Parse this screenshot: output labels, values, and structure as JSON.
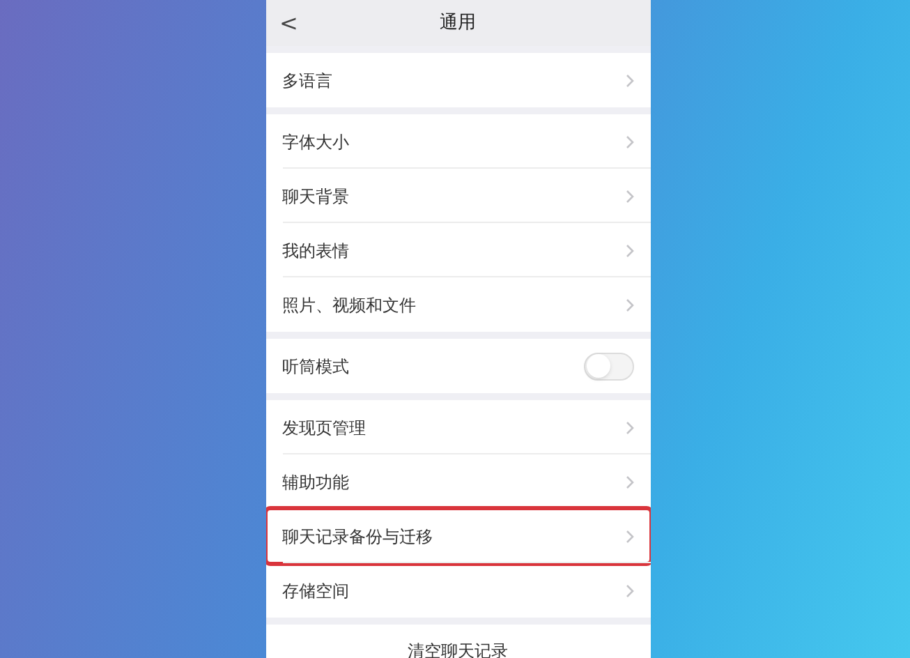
{
  "header": {
    "back": "<",
    "title": "通用"
  },
  "groups": [
    {
      "items": [
        {
          "kind": "link",
          "label": "多语言",
          "highlighted": false
        }
      ]
    },
    {
      "items": [
        {
          "kind": "link",
          "label": "字体大小",
          "highlighted": false
        },
        {
          "kind": "link",
          "label": "聊天背景",
          "highlighted": false
        },
        {
          "kind": "link",
          "label": "我的表情",
          "highlighted": false
        },
        {
          "kind": "link",
          "label": "照片、视频和文件",
          "highlighted": false
        }
      ]
    },
    {
      "items": [
        {
          "kind": "toggle",
          "label": "听筒模式",
          "on": false,
          "highlighted": false
        }
      ]
    },
    {
      "items": [
        {
          "kind": "link",
          "label": "发现页管理",
          "highlighted": false
        },
        {
          "kind": "link",
          "label": "辅助功能",
          "highlighted": false
        },
        {
          "kind": "link",
          "label": "聊天记录备份与迁移",
          "highlighted": true
        },
        {
          "kind": "link",
          "label": "存储空间",
          "highlighted": false
        }
      ]
    }
  ],
  "clear_button": "清空聊天记录"
}
